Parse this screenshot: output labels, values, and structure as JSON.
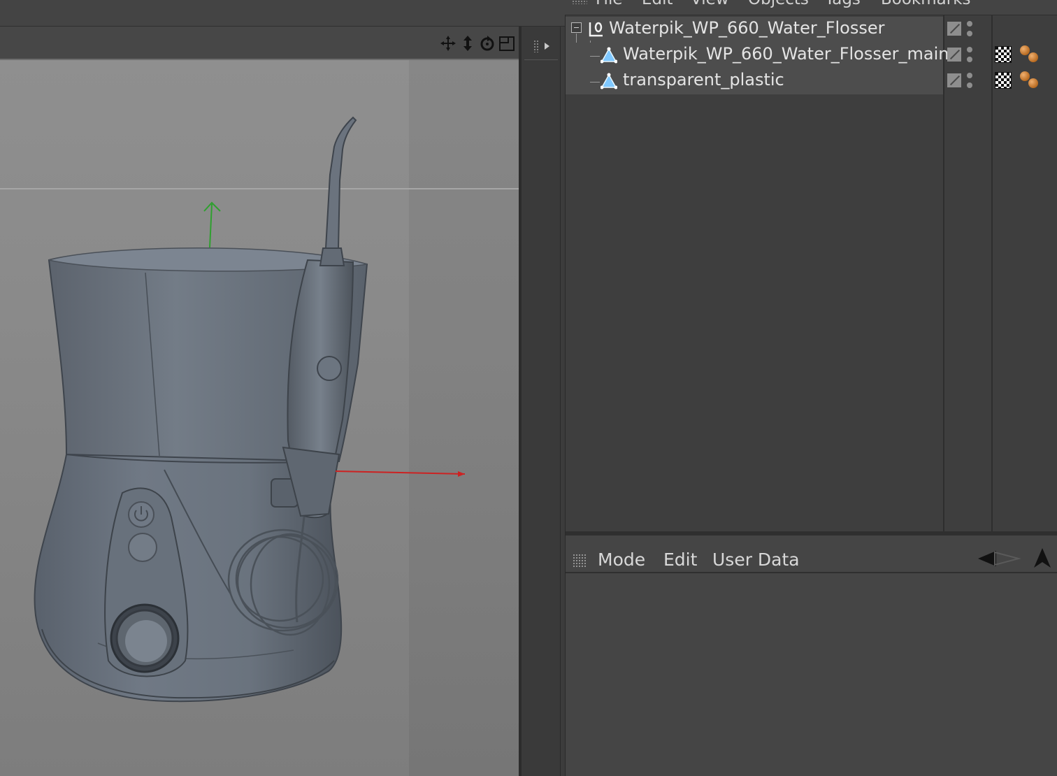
{
  "object_manager": {
    "menus": [
      "File",
      "Edit",
      "View",
      "Objects",
      "Tags",
      "Bookmarks"
    ],
    "objects": [
      {
        "name": "Waterpik_WP_660_Water_Flosser",
        "type": "null-object",
        "tags": []
      },
      {
        "name": "Waterpik_WP_660_Water_Flosser_main",
        "type": "polygon-object",
        "tags": [
          "texture-tag",
          "material-tag"
        ]
      },
      {
        "name": "transparent_plastic",
        "type": "polygon-object",
        "tags": [
          "texture-tag",
          "material-tag"
        ]
      }
    ]
  },
  "attribute_manager": {
    "menus": [
      "Mode",
      "Edit",
      "User Data"
    ]
  },
  "viewport": {
    "nav_icons": [
      "move-view-icon",
      "dolly-view-icon",
      "rotate-view-icon",
      "maximize-view-icon"
    ],
    "axis_colors": {
      "x": "#cc2222",
      "y": "#2fa02f"
    }
  },
  "colors": {
    "panel_bg": "#3e3e3e",
    "row_highlight": "#4d4d4d",
    "viewport_bg": "#8a8a8a",
    "model_body": "#6f7884"
  }
}
